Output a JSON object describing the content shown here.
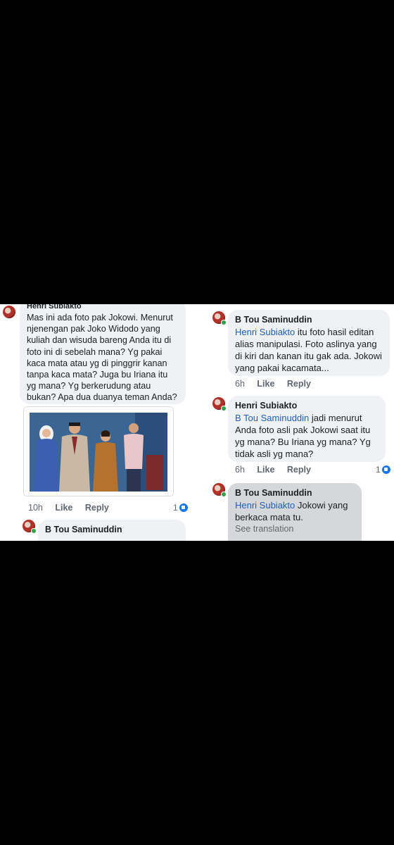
{
  "left": {
    "comment1": {
      "author": "Henri Subiakto",
      "text": "Mas ini ada foto pak Jokowi. Menurut njenengan pak Joko Widodo yang kuliah dan wisuda bareng Anda itu di foto ini di sebelah mana? Yg pakai kaca mata atau yg di pinggrir kanan tanpa kaca mata? Juga bu Iriana itu yg mana? Yg berkerudung atau bukan? Apa dua duanya teman Anda?",
      "time": "10h",
      "like": "Like",
      "reply": "Reply",
      "reaction_count": "1"
    },
    "comment2": {
      "author": "B Tou Saminuddin"
    }
  },
  "right": {
    "comment1": {
      "author": "B Tou Saminuddin",
      "mention": "Henri Subiakto",
      "text": " itu foto hasil editan alias manipulasi. Foto aslinya yang di kiri dan kanan itu gak ada. Jokowi yang pakai kacamata...",
      "time": "6h",
      "like": "Like",
      "reply": "Reply"
    },
    "comment2": {
      "author": "Henri Subiakto",
      "mention": "B Tou Saminuddin",
      "text": "  jadi menurut Anda foto asli pak Jokowi saat itu yg mana? Bu Iriana yg mana? Yg tidak asli yg mana?",
      "time": "6h",
      "like": "Like",
      "reply": "Reply",
      "reaction_count": "1"
    },
    "comment3": {
      "author": "B Tou Saminuddin",
      "mention": "Henri Subiakto",
      "text": " Jokowi yang berkaca mata tu.",
      "see_translation": "See translation"
    }
  },
  "icons": {
    "avatar": "avatar-icon",
    "like_badge": "like-reaction-icon",
    "online": "online-status-icon"
  },
  "colors": {
    "background": "#000000",
    "bubble": "#eff1f4",
    "mention": "#1f5fb7",
    "like_blue": "#1877f2",
    "online_green": "#31a24c"
  }
}
